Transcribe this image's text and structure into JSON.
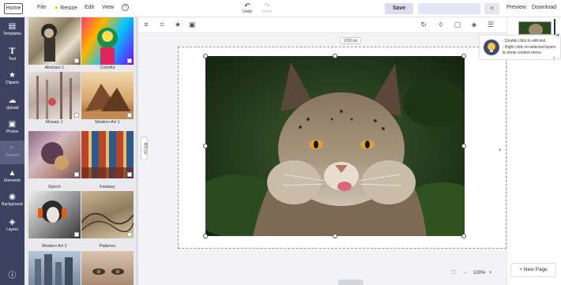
{
  "topbar": {
    "home": "Home",
    "file": "File",
    "resize": "Resize",
    "edit": "Edit",
    "view": "View",
    "help_icon": "question-circle-icon",
    "undo": "Undo",
    "redo": "Redo",
    "save": "Save",
    "share_icon": "share-icon",
    "preview": "Preview",
    "download": "Download"
  },
  "nav": [
    {
      "label": "Templates",
      "icon": "templates-icon"
    },
    {
      "label": "Text",
      "icon": "text-icon"
    },
    {
      "label": "Cliparts",
      "icon": "star-icon"
    },
    {
      "label": "Upload",
      "icon": "upload-cloud-icon"
    },
    {
      "label": "Photos",
      "icon": "photo-icon"
    },
    {
      "label": "Custom",
      "icon": "crop-icon"
    },
    {
      "label": "Elements",
      "icon": "shapes-icon"
    },
    {
      "label": "Background",
      "icon": "palette-icon"
    },
    {
      "label": "Layers",
      "icon": "layers-icon"
    },
    {
      "label": "",
      "icon": "info-icon"
    }
  ],
  "filters": [
    {
      "label": "Abstract 1"
    },
    {
      "label": "Colorful"
    },
    {
      "label": "Mosaic 1"
    },
    {
      "label": "Modern Art 1"
    },
    {
      "label": "Epoch"
    },
    {
      "label": "Fantasy"
    },
    {
      "label": "Modern Art 2"
    },
    {
      "label": "Patterns"
    },
    {
      "label": ""
    },
    {
      "label": ""
    }
  ],
  "canvas": {
    "width_label": "1200 px",
    "height_label": "800 px"
  },
  "tip": {
    "line1": "- Double click to edit text",
    "line2": "- Right click on selected layers",
    "line3": "to show context menu"
  },
  "zoom": {
    "value": "100%"
  },
  "new_page": "+ New Page",
  "colors": {
    "nav_bg": "#3d4260",
    "save_bg": "#dcdcee",
    "accent": "#3f4a70"
  }
}
